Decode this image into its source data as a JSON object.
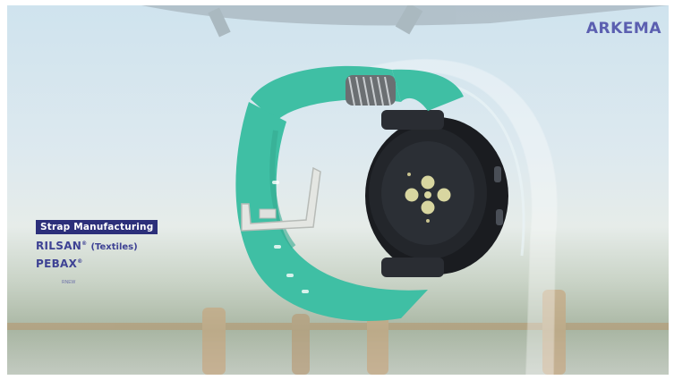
{
  "brand": {
    "logo_text": "ARKEMA"
  },
  "callout": {
    "tag": "Strap Manufacturing",
    "item1_brand": "RILSAN",
    "item1_note": "(Textiles)",
    "item2_brand": "PEBAX",
    "item2_sub": "RNEW",
    "registered": "®"
  },
  "colors": {
    "strap": "#3fbfa4",
    "strap_dark": "#2fa68d",
    "watch_body": "#1e2125",
    "sensor": "#d8d6a0",
    "brand_purple": "#5b5fb0",
    "tag_bg": "#2c2f7a"
  }
}
